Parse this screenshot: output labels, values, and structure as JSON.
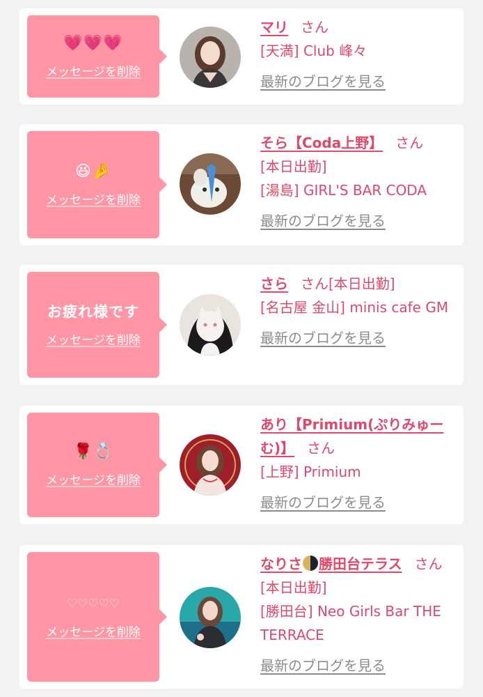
{
  "delete_label": "メッセージを削除",
  "blog_label": "最新のブログを見る",
  "san": "さん",
  "items": [
    {
      "message": "💗💗💗",
      "name": "マリ",
      "status": "",
      "venue": "[天満] Club 峰々",
      "avatar": "portrait-dark-hair-icon"
    },
    {
      "message": "😆🤌",
      "name": "そら【Coda上野】",
      "status": "[本日出勤]",
      "venue": "[湯島] GIRL'S BAR CODA",
      "avatar": "plush-toy-photo-icon"
    },
    {
      "message": "お疲れ様です",
      "name": "さら",
      "status": "[本日出勤]",
      "venue": "[名古屋 金山] minis cafe GM",
      "avatar": "cat-mask-portrait-icon"
    },
    {
      "message": "🌹💍",
      "name": "あり【Primium(ぷりみゅーむ)】",
      "status": "",
      "venue": "[上野] Primium",
      "avatar": "red-dress-portrait-icon"
    },
    {
      "message": "♡♡♡♡♡",
      "name_part1": "なりさ",
      "name_part2": "勝田台テラス",
      "status": "[本日出勤]",
      "venue": "[勝田台] Neo Girls Bar THE TERRACE",
      "avatar": "teal-background-portrait-icon"
    }
  ],
  "colors": {
    "accent": "#e0486a",
    "bubble": "#ff95a5",
    "muted": "#8c8c8c",
    "background": "#f2f2f2"
  }
}
